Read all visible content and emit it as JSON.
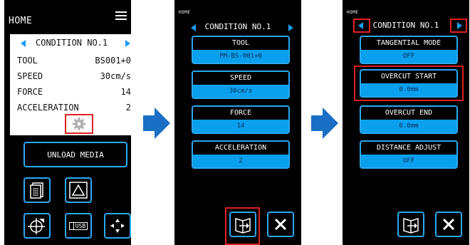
{
  "screen1": {
    "home": "HOME",
    "condition": "CONDITION NO.1",
    "rows": [
      {
        "label": "TOOL",
        "value": "BS001+0"
      },
      {
        "label": "SPEED",
        "value": "30cm/s"
      },
      {
        "label": "FORCE",
        "value": "14"
      },
      {
        "label": "ACCELERATION",
        "value": "2"
      }
    ],
    "unload": "UNLOAD MEDIA",
    "usb": "USB"
  },
  "screen2": {
    "home": "HOME",
    "condition": "CONDITION NO.1",
    "settings": [
      {
        "label": "TOOL",
        "value": "PM-BS-001+0"
      },
      {
        "label": "SPEED",
        "value": "30cm/s"
      },
      {
        "label": "FORCE",
        "value": "14"
      },
      {
        "label": "ACCELERATION",
        "value": "2"
      }
    ]
  },
  "screen3": {
    "home": "HOME",
    "condition": "CONDITION NO.1",
    "settings": [
      {
        "label": "TANGENTIAL MODE",
        "value": "OFF"
      },
      {
        "label": "OVERCUT START",
        "value": "0.0mm"
      },
      {
        "label": "OVERCUT END",
        "value": "0.0mm"
      },
      {
        "label": "DISTANCE ADJUST",
        "value": "OFF"
      }
    ]
  },
  "colors": {
    "accent": "#29a9f5",
    "highlight": "#e02020",
    "value_bg": "#0aa0ee",
    "flow_arrow": "#1a6fc4"
  }
}
